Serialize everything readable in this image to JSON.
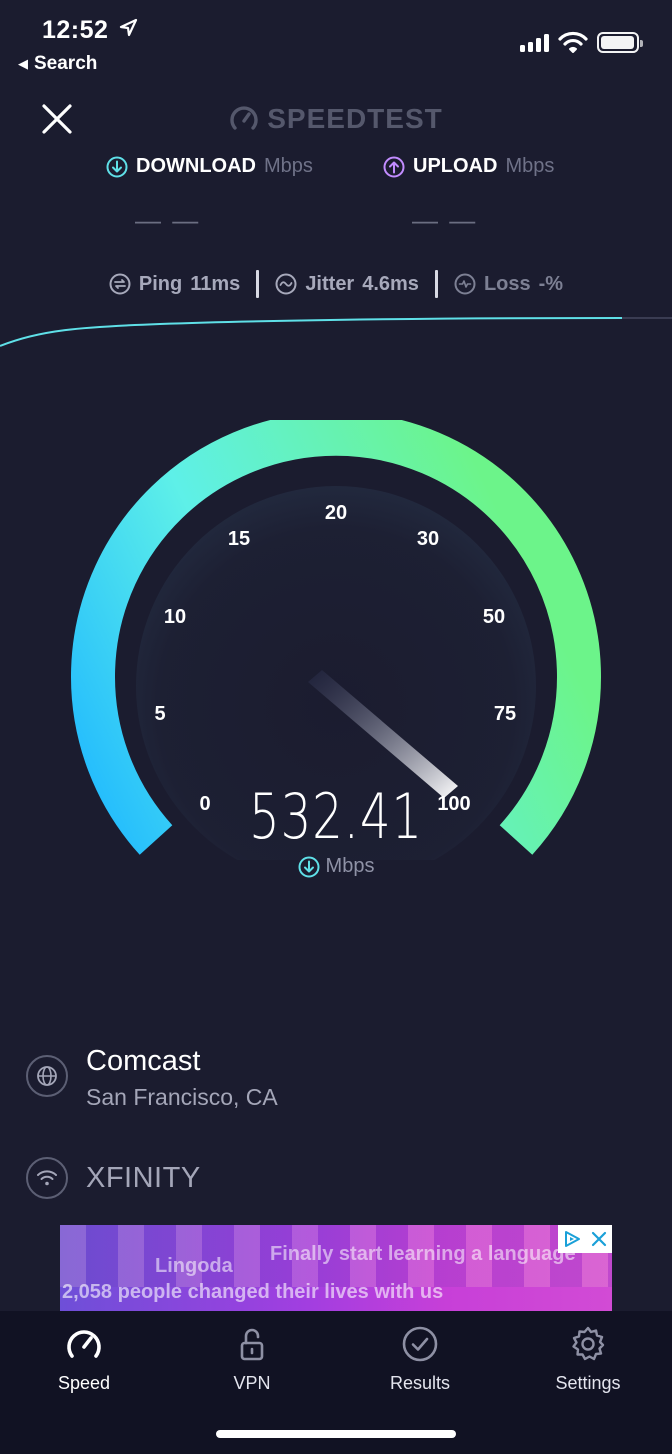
{
  "status_bar": {
    "time": "12:52",
    "back_label": "Search"
  },
  "header": {
    "brand": "SPEEDTEST"
  },
  "download": {
    "label": "DOWNLOAD",
    "unit": "Mbps",
    "value": "— —"
  },
  "upload": {
    "label": "UPLOAD",
    "unit": "Mbps",
    "value": "— —"
  },
  "stats": {
    "ping_label": "Ping",
    "ping_value": "11ms",
    "jitter_label": "Jitter",
    "jitter_value": "4.6ms",
    "loss_label": "Loss",
    "loss_value": "-%"
  },
  "gauge": {
    "ticks": [
      "0",
      "5",
      "10",
      "15",
      "20",
      "30",
      "50",
      "75",
      "100"
    ],
    "current_value": "532.41",
    "unit": "Mbps",
    "gradient_start": "#1fb8ff",
    "gradient_mid": "#5ef0e8",
    "gradient_end": "#6cf48a"
  },
  "server": {
    "isp": "Comcast",
    "location": "San Francisco, CA"
  },
  "network": {
    "name": "XFINITY"
  },
  "ad": {
    "brand": "Lingoda",
    "headline": "Finally start learning a language",
    "subline": "2,058 people changed their lives with us"
  },
  "tabbar": {
    "items": [
      {
        "label": "Speed",
        "icon": "speedometer-icon"
      },
      {
        "label": "VPN",
        "icon": "unlock-icon"
      },
      {
        "label": "Results",
        "icon": "check-circle-icon"
      },
      {
        "label": "Settings",
        "icon": "gear-icon"
      }
    ]
  },
  "colors": {
    "background": "#1b1c2f",
    "download_accent": "#5fe0e8",
    "upload_accent": "#c28cff",
    "graph_line": "#5fe0e8"
  }
}
